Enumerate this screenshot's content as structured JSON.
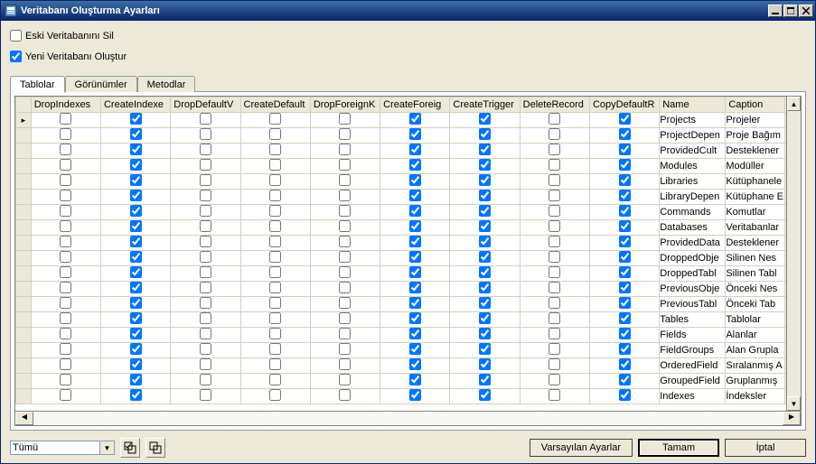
{
  "window": {
    "title": "Veritabanı Oluşturma Ayarları"
  },
  "checks": {
    "delete_old_db": {
      "label": "Eski Veritabanını Sil",
      "checked": false
    },
    "create_new_db": {
      "label": "Yeni Veritabanı Oluştur",
      "checked": true
    }
  },
  "tabs": [
    {
      "label": "Tablolar",
      "active": true
    },
    {
      "label": "Görünümler",
      "active": false
    },
    {
      "label": "Metodlar",
      "active": false
    }
  ],
  "columns": [
    "DropIndexes",
    "CreateIndexe",
    "DropDefaultV",
    "CreateDefault",
    "DropForeignK",
    "CreateForeig",
    "CreateTrigger",
    "DeleteRecord",
    "CopyDefaultR",
    "Name",
    "Caption"
  ],
  "rows": [
    {
      "c": [
        false,
        true,
        false,
        false,
        false,
        true,
        true,
        false,
        true
      ],
      "name": "Projects",
      "caption": "Projeler"
    },
    {
      "c": [
        false,
        true,
        false,
        false,
        false,
        true,
        true,
        false,
        true
      ],
      "name": "ProjectDepen",
      "caption": "Proje Bağım"
    },
    {
      "c": [
        false,
        true,
        false,
        false,
        false,
        true,
        true,
        false,
        true
      ],
      "name": "ProvidedCult",
      "caption": "Desteklener"
    },
    {
      "c": [
        false,
        true,
        false,
        false,
        false,
        true,
        true,
        false,
        true
      ],
      "name": "Modules",
      "caption": "Modüller"
    },
    {
      "c": [
        false,
        true,
        false,
        false,
        false,
        true,
        true,
        false,
        true
      ],
      "name": "Libraries",
      "caption": "Kütüphanele"
    },
    {
      "c": [
        false,
        true,
        false,
        false,
        false,
        true,
        true,
        false,
        true
      ],
      "name": "LibraryDepen",
      "caption": "Kütüphane E"
    },
    {
      "c": [
        false,
        true,
        false,
        false,
        false,
        true,
        true,
        false,
        true
      ],
      "name": "Commands",
      "caption": "Komutlar"
    },
    {
      "c": [
        false,
        true,
        false,
        false,
        false,
        true,
        true,
        false,
        true
      ],
      "name": "Databases",
      "caption": "Veritabanlar"
    },
    {
      "c": [
        false,
        true,
        false,
        false,
        false,
        true,
        true,
        false,
        true
      ],
      "name": "ProvidedData",
      "caption": "Desteklener"
    },
    {
      "c": [
        false,
        true,
        false,
        false,
        false,
        true,
        true,
        false,
        true
      ],
      "name": "DroppedObje",
      "caption": "Silinen Nes"
    },
    {
      "c": [
        false,
        true,
        false,
        false,
        false,
        true,
        true,
        false,
        true
      ],
      "name": "DroppedTabl",
      "caption": "Silinen Tabl"
    },
    {
      "c": [
        false,
        true,
        false,
        false,
        false,
        true,
        true,
        false,
        true
      ],
      "name": "PreviousObje",
      "caption": "Önceki Nes"
    },
    {
      "c": [
        false,
        true,
        false,
        false,
        false,
        true,
        true,
        false,
        true
      ],
      "name": "PreviousTabl",
      "caption": "Önceki Tab"
    },
    {
      "c": [
        false,
        true,
        false,
        false,
        false,
        true,
        true,
        false,
        true
      ],
      "name": "Tables",
      "caption": "Tablolar"
    },
    {
      "c": [
        false,
        true,
        false,
        false,
        false,
        true,
        true,
        false,
        true
      ],
      "name": "Fields",
      "caption": "Alanlar"
    },
    {
      "c": [
        false,
        true,
        false,
        false,
        false,
        true,
        true,
        false,
        true
      ],
      "name": "FieldGroups",
      "caption": "Alan Grupla"
    },
    {
      "c": [
        false,
        true,
        false,
        false,
        false,
        true,
        true,
        false,
        true
      ],
      "name": "OrderedField",
      "caption": "Sıralanmış A"
    },
    {
      "c": [
        false,
        true,
        false,
        false,
        false,
        true,
        true,
        false,
        true
      ],
      "name": "GroupedField",
      "caption": "Gruplanmış"
    },
    {
      "c": [
        false,
        true,
        false,
        false,
        false,
        true,
        true,
        false,
        true
      ],
      "name": "Indexes",
      "caption": "İndeksler"
    }
  ],
  "footer": {
    "filter_value": "Tümü",
    "defaults": "Varsayılan Ayarlar",
    "ok": "Tamam",
    "cancel": "İptal"
  }
}
